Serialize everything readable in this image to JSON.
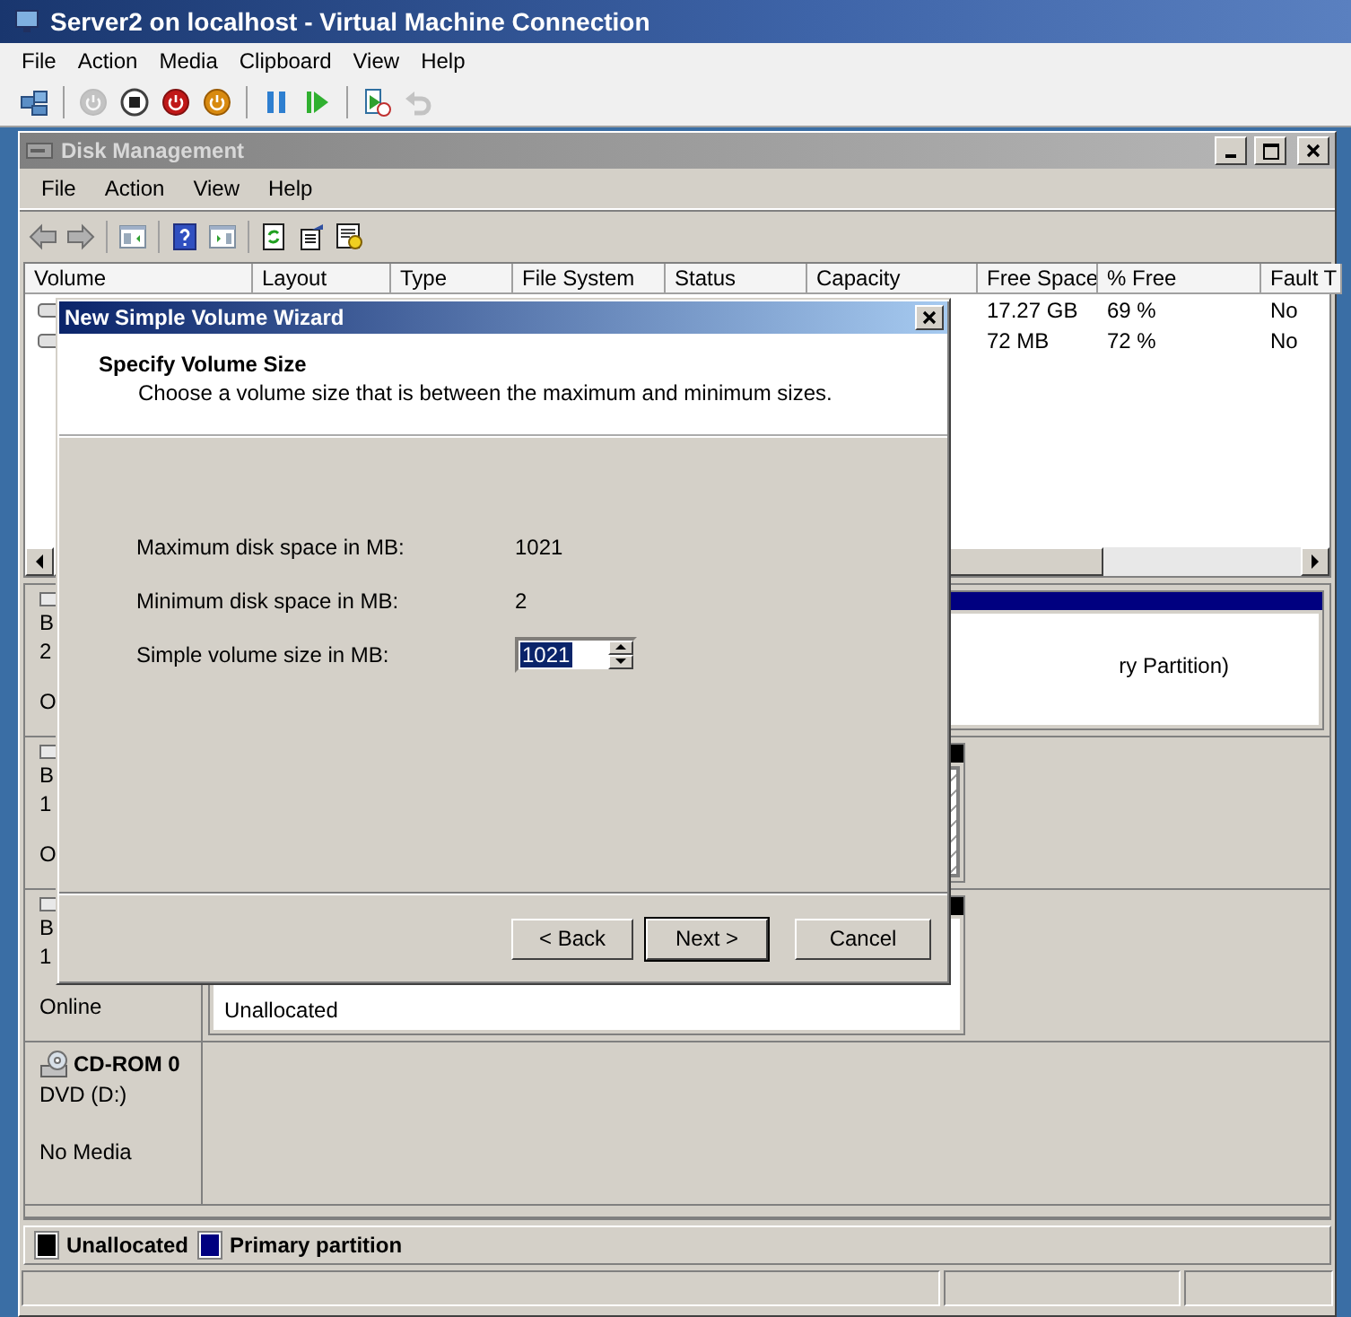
{
  "window": {
    "title": "Server2 on localhost - Virtual Machine Connection"
  },
  "menu": [
    "File",
    "Action",
    "Media",
    "Clipboard",
    "View",
    "Help"
  ],
  "toolbar": [
    {
      "kind": "ctrl-alt-del",
      "disabled": false
    },
    {
      "kind": "start",
      "disabled": true
    },
    {
      "kind": "turn-off",
      "disabled": false
    },
    {
      "kind": "shut-down",
      "disabled": false
    },
    {
      "kind": "save",
      "disabled": false
    },
    {
      "kind": "pause",
      "disabled": false
    },
    {
      "kind": "resume",
      "disabled": false
    },
    {
      "kind": "snapshot",
      "disabled": false
    },
    {
      "kind": "revert",
      "disabled": true
    }
  ],
  "disk_management": {
    "title": "Disk Management",
    "menu": [
      "File",
      "Action",
      "View",
      "Help"
    ],
    "toolbar": [
      {
        "kind": "back"
      },
      {
        "kind": "forward"
      },
      {
        "kind": "console-tree"
      },
      {
        "kind": "help"
      },
      {
        "kind": "action-pane"
      },
      {
        "kind": "refresh"
      },
      {
        "kind": "properties"
      },
      {
        "kind": "settings"
      }
    ],
    "volume_table": {
      "columns": [
        "Volume",
        "Layout",
        "Type",
        "File System",
        "Status",
        "Capacity",
        "Free Space",
        "% Free",
        "Fault T"
      ],
      "rows": [
        {
          "free_space": "17.27 GB",
          "percent_free": "69 %",
          "fault_tolerance": "No"
        },
        {
          "free_space": "72 MB",
          "percent_free": "72 %",
          "fault_tolerance": "No"
        }
      ]
    },
    "disks": [
      {
        "kind": "basic",
        "name": "B",
        "size": "2",
        "status": "O",
        "partitions": [
          {
            "kind": "primary",
            "selected": false,
            "text": "ry Partition)"
          }
        ]
      },
      {
        "kind": "basic",
        "name": "B",
        "size": "1",
        "status": "O",
        "partitions": [
          {
            "kind": "unallocated",
            "selected": true
          }
        ]
      },
      {
        "kind": "basic",
        "name": "B",
        "size": "1",
        "status": "Online",
        "partitions": [
          {
            "kind": "unallocated",
            "selected": false,
            "text": "Unallocated"
          }
        ]
      },
      {
        "kind": "cdrom",
        "name": "CD-ROM 0",
        "size": "DVD (D:)",
        "status": "No Media"
      }
    ],
    "legend": [
      {
        "label": "Unallocated",
        "color": "#000000"
      },
      {
        "label": "Primary partition",
        "color": "#000080"
      }
    ]
  },
  "wizard": {
    "title": "New Simple Volume Wizard",
    "heading": "Specify Volume Size",
    "description": "Choose a volume size that is between the maximum and minimum sizes.",
    "fields": [
      {
        "kind": "readout",
        "label": "Maximum disk space in MB:",
        "value": "1021"
      },
      {
        "kind": "readout",
        "label": "Minimum disk space in MB:",
        "value": "2"
      },
      {
        "kind": "spinner",
        "label": "Simple volume size in MB:",
        "value": "1021",
        "text_selected": true
      }
    ],
    "buttons": [
      {
        "label": "< Back",
        "default": false
      },
      {
        "label": "Next >",
        "default": true
      },
      {
        "label": "Cancel",
        "default": false
      }
    ]
  }
}
